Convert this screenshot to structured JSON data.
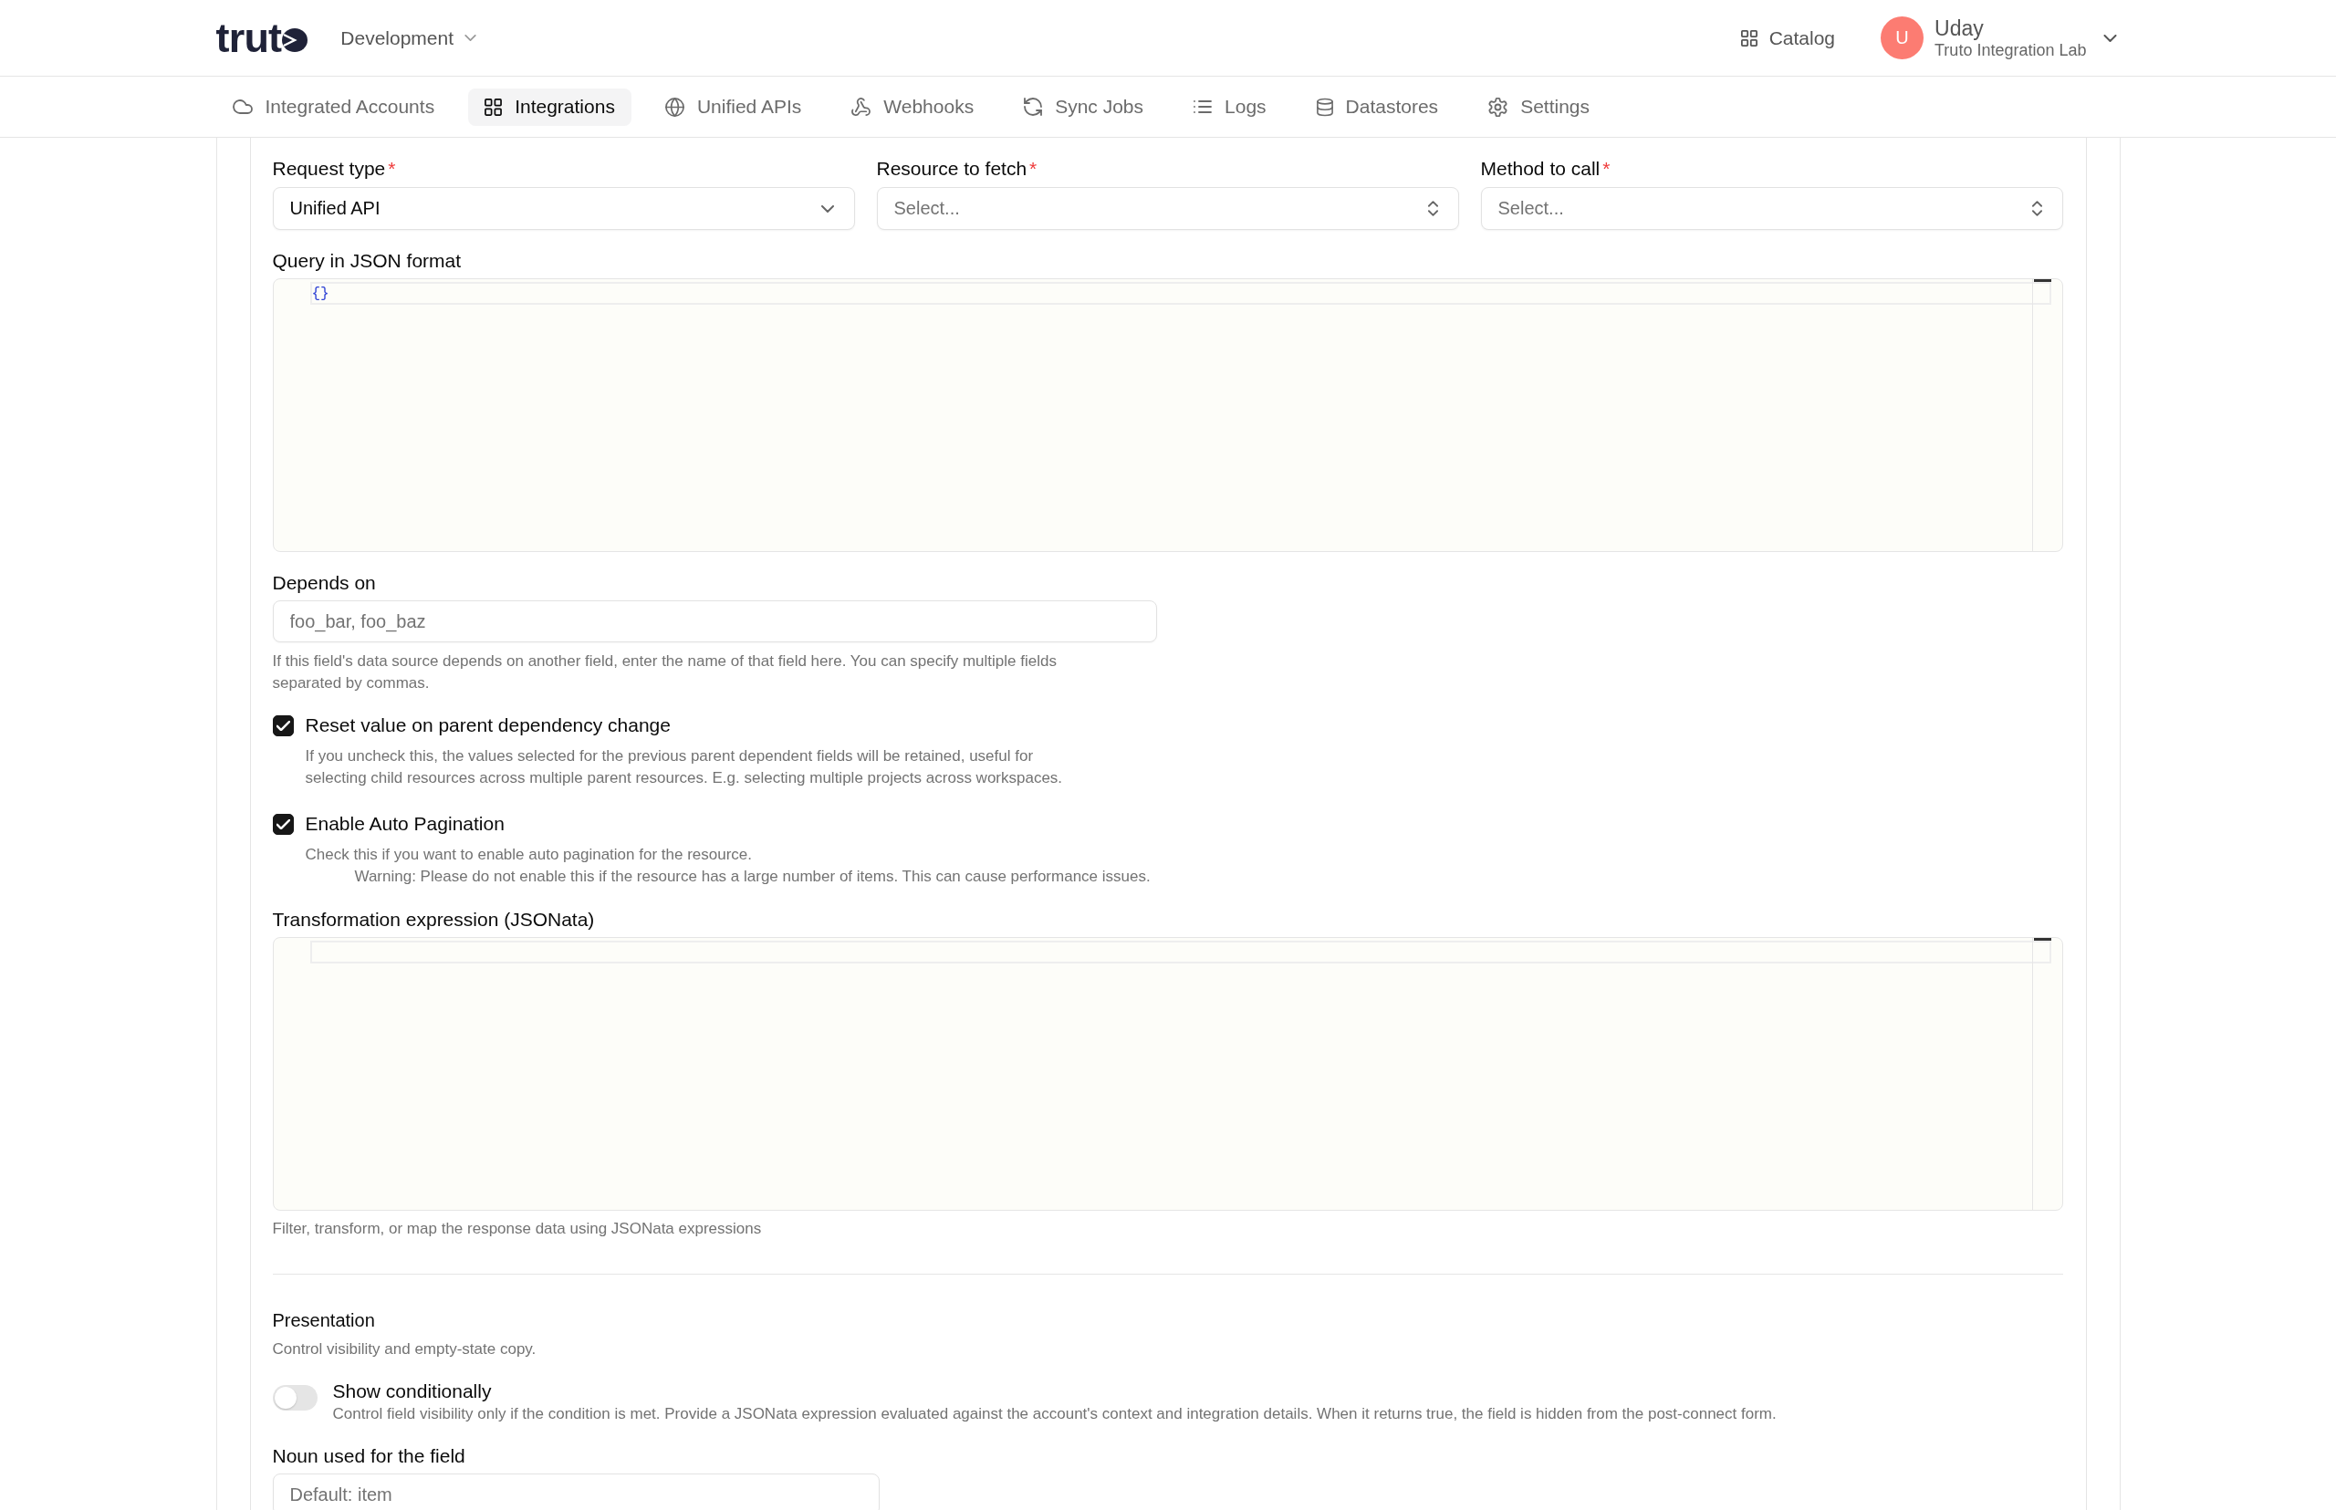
{
  "header": {
    "logo": "trut",
    "environment": "Development",
    "catalog": "Catalog",
    "user": {
      "initial": "U",
      "name": "Uday",
      "organization": "Truto Integration Lab"
    }
  },
  "nav": {
    "tabs": [
      {
        "label": "Integrated Accounts",
        "selected": false
      },
      {
        "label": "Integrations",
        "selected": true
      },
      {
        "label": "Unified APIs",
        "selected": false
      },
      {
        "label": "Webhooks",
        "selected": false
      },
      {
        "label": "Sync Jobs",
        "selected": false
      },
      {
        "label": "Logs",
        "selected": false
      },
      {
        "label": "Datastores",
        "selected": false
      },
      {
        "label": "Settings",
        "selected": false
      }
    ]
  },
  "form": {
    "source_fields": [
      {
        "label": "Request type",
        "required_mark": "*",
        "kind": "dropdown",
        "value": "Unified API"
      },
      {
        "label": "Resource to fetch",
        "required_mark": "*",
        "kind": "combobox",
        "placeholder": "Select..."
      },
      {
        "label": "Method to call",
        "required_mark": "*",
        "kind": "combobox",
        "placeholder": "Select..."
      }
    ],
    "query": {
      "label": "Query in JSON format",
      "lines": [
        "{}"
      ]
    },
    "depends_on": {
      "label": "Depends on",
      "placeholder": "foo_bar, foo_baz",
      "help": "If this field's data source depends on another field, enter the name of that field here. You can specify multiple fields separated by commas."
    },
    "options": [
      {
        "label": "Reset value on parent dependency change",
        "checked": true,
        "help": "If you uncheck this, the values selected for the previous parent dependent fields will be retained, useful for selecting child resources across multiple parent resources. E.g. selecting multiple projects across workspaces."
      },
      {
        "label": "Enable Auto Pagination",
        "checked": true,
        "help": "Check this if you want to enable auto pagination for the resource.",
        "warning": "Warning: Please do not enable this if the resource has a large number of items. This can cause performance issues."
      }
    ],
    "transformation": {
      "label": "Transformation expression (JSONata)",
      "help": "Filter, transform, or map the response data using JSONata expressions"
    }
  },
  "presentation": {
    "title": "Presentation",
    "subtitle": "Control visibility and empty-state copy.",
    "show_conditionally": {
      "label": "Show conditionally",
      "on": false,
      "help": "Control field visibility only if the condition is met. Provide a JSONata expression evaluated against the account's context and integration details. When it returns true, the field is hidden from the post-connect form."
    },
    "noun": {
      "label": "Noun used for the field",
      "placeholder": "Default: item"
    }
  }
}
